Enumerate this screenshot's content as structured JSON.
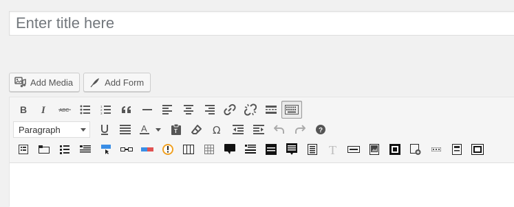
{
  "title_field": {
    "placeholder": "Enter title here",
    "value": ""
  },
  "media_buttons": {
    "add_media_label": "Add Media",
    "add_form_label": "Add Form"
  },
  "toolbar": {
    "row1": [
      "bold",
      "italic",
      "strikethrough",
      "bulleted-list",
      "numbered-list",
      "blockquote",
      "horizontal-line",
      "align-left",
      "align-center",
      "align-right",
      "insert-link",
      "remove-link",
      "read-more",
      "toolbar-toggle"
    ],
    "format_select": {
      "value": "Paragraph"
    },
    "row2": [
      "underline",
      "justify",
      "text-color",
      "paste-as-text",
      "clear-formatting",
      "special-character",
      "decrease-indent",
      "increase-indent",
      "undo",
      "redo",
      "keyboard-shortcuts"
    ],
    "row3": [
      "shortcode-1",
      "shortcode-2",
      "shortcode-3",
      "shortcode-4",
      "shortcode-5",
      "shortcode-6",
      "shortcode-7",
      "shortcode-8",
      "shortcode-9",
      "shortcode-10",
      "shortcode-11",
      "shortcode-12",
      "shortcode-13",
      "shortcode-14",
      "shortcode-15",
      "shortcode-16",
      "shortcode-17",
      "shortcode-18",
      "shortcode-19",
      "shortcode-20",
      "shortcode-21",
      "shortcode-22",
      "shortcode-23",
      "shortcode-24"
    ]
  },
  "colors": {
    "background": "#f1f1f1",
    "toolbar_bg": "#f5f5f5",
    "icon": "#555555",
    "accent_blue": "#3a8ee6",
    "accent_red": "#e05252",
    "accent_orange": "#f0a020"
  },
  "editor": {
    "content": ""
  }
}
